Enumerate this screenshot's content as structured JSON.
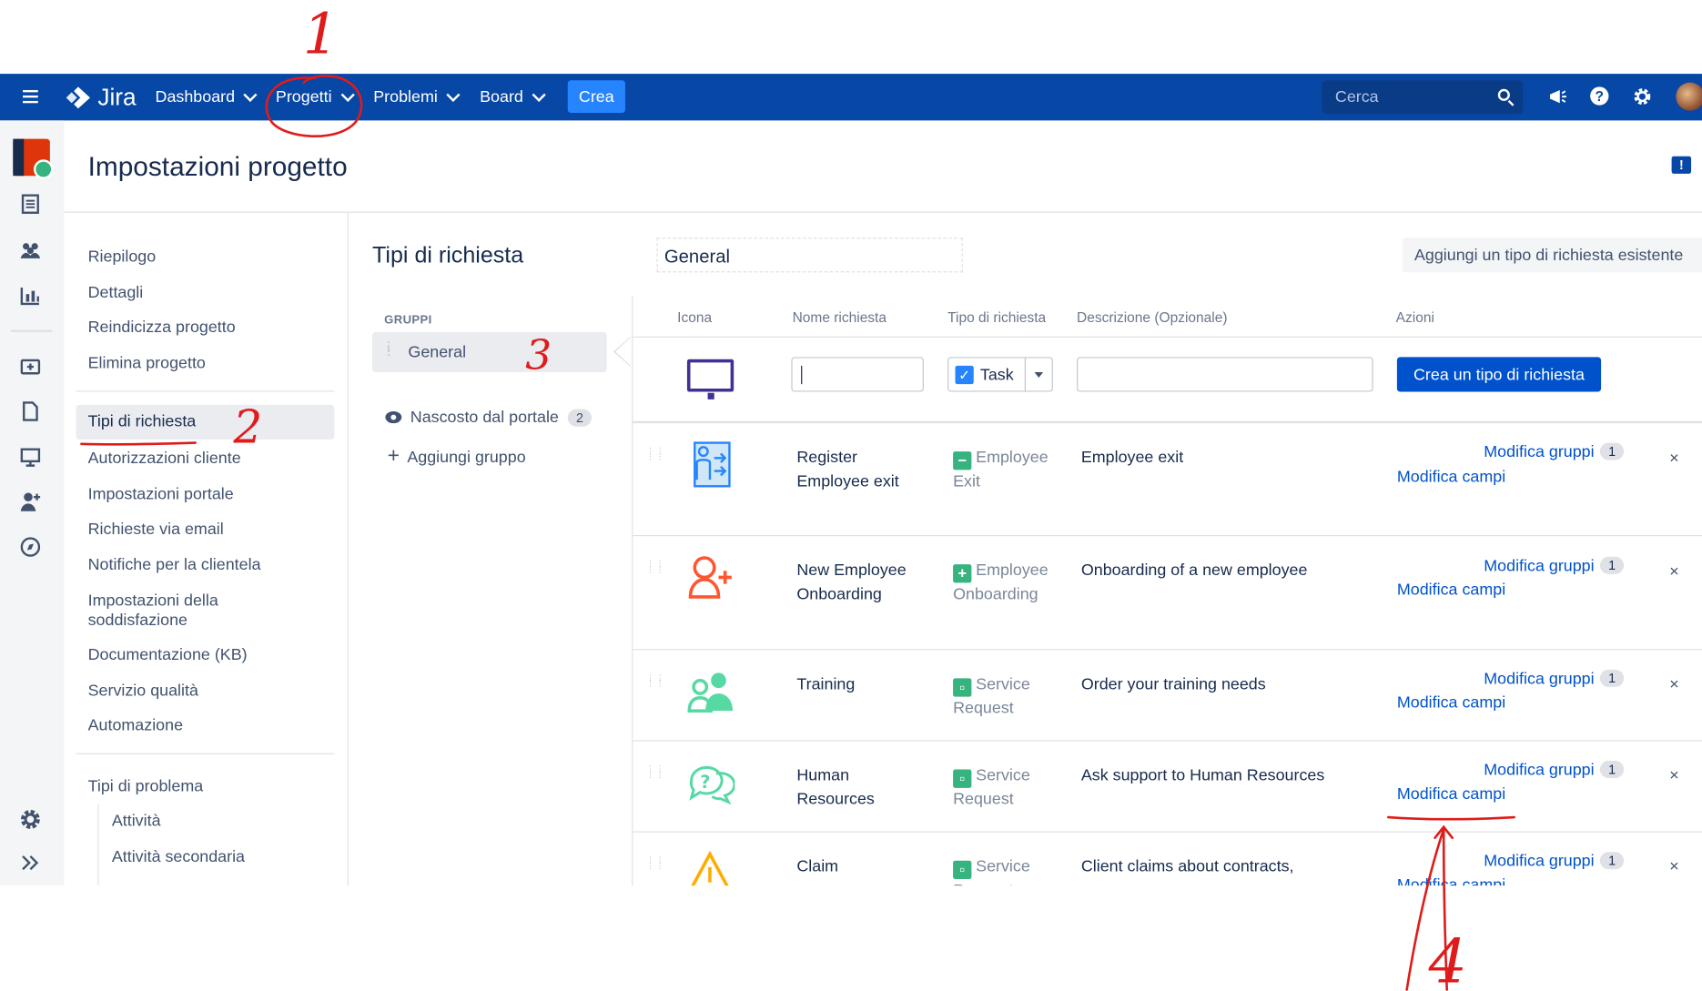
{
  "topnav": {
    "logo": "Jira",
    "items": [
      "Dashboard",
      "Progetti",
      "Problemi",
      "Board"
    ],
    "create_label": "Crea",
    "search_placeholder": "Cerca"
  },
  "header": {
    "title": "Impostazioni progetto"
  },
  "settings_nav": {
    "group1": [
      "Riepilogo",
      "Dettagli",
      "Reindicizza progetto",
      "Elimina progetto"
    ],
    "selected": "Tipi di richiesta",
    "group2": [
      "Autorizzazioni cliente",
      "Impostazioni portale",
      "Richieste via email",
      "Notifiche per la clientela",
      "Impostazioni della soddisfazione",
      "Documentazione (KB)",
      "Servizio qualità",
      "Automazione"
    ],
    "issue_types_label": "Tipi di problema",
    "issue_types": [
      "Attività",
      "Attività secondaria"
    ]
  },
  "groups_panel": {
    "title": "Tipi di richiesta",
    "groups_heading": "GRUPPI",
    "selected_group": "General",
    "hidden_label": "Nascosto dal portale",
    "hidden_count": "2",
    "add_group": "Aggiungi gruppo"
  },
  "main": {
    "group_name_value": "General",
    "add_existing_button": "Aggiungi un tipo di richiesta esistente",
    "columns": {
      "icon": "Icona",
      "name": "Nome richiesta",
      "type": "Tipo di richiesta",
      "description": "Descrizione",
      "description_optional": "(Opzionale)",
      "actions": "Azioni"
    },
    "new_row": {
      "name_value": "",
      "type_value": "Task",
      "description_value": "",
      "create_button": "Crea un tipo di richiesta"
    },
    "rows": [
      {
        "name": "Register Employee exit",
        "type": "Employee Exit",
        "type_color": "#36b37e",
        "description": "Employee exit",
        "edit_groups": "Modifica gruppi",
        "groups_count": "1",
        "edit_fields": "Modifica campi",
        "icon": "employee-exit-icon"
      },
      {
        "name": "New Employee Onboarding",
        "type": "Employee Onboarding",
        "type_color": "#36b37e",
        "description": "Onboarding of a new employee",
        "edit_groups": "Modifica gruppi",
        "groups_count": "1",
        "edit_fields": "Modifica campi",
        "icon": "add-user-icon"
      },
      {
        "name": "Training",
        "type": "Service Request",
        "type_color": "#36b37e",
        "description": "Order your training needs",
        "edit_groups": "Modifica gruppi",
        "groups_count": "1",
        "edit_fields": "Modifica campi",
        "icon": "training-icon"
      },
      {
        "name": "Human Resources",
        "type": "Service Request",
        "type_color": "#36b37e",
        "description": "Ask support to Human Resources",
        "edit_groups": "Modifica gruppi",
        "groups_count": "1",
        "edit_fields": "Modifica campi",
        "icon": "question-chat-icon"
      },
      {
        "name": "Claim",
        "type": "Service Request",
        "type_color": "#36b37e",
        "description": "Client claims about contracts,",
        "edit_groups": "Modifica gruppi",
        "groups_count": "1",
        "edit_fields": "Modifica campi",
        "icon": "warning-icon"
      }
    ]
  },
  "annotations": [
    "1",
    "2",
    "3",
    "4"
  ],
  "colors": {
    "nav_bg": "#0747a6",
    "create_btn": "#2684ff",
    "primary": "#0052cc",
    "annotation": "#e01b1b"
  }
}
